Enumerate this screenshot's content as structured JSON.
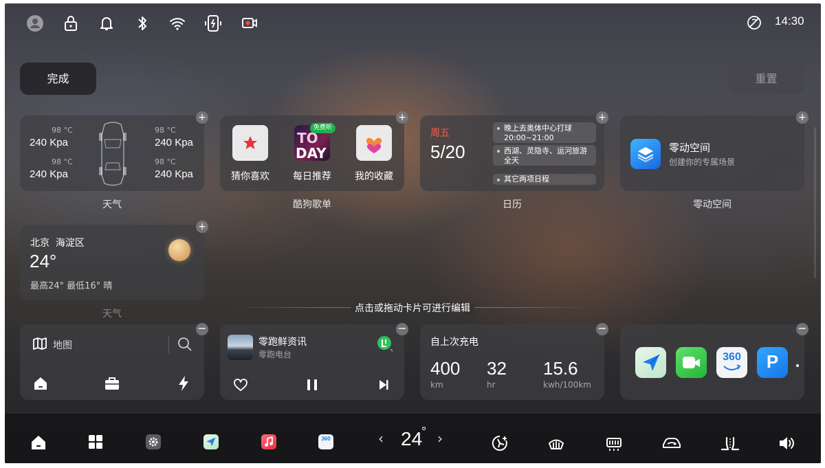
{
  "status_bar": {
    "time": "14:30",
    "icons": [
      "profile-icon",
      "lock-icon",
      "bell-icon",
      "bluetooth-icon",
      "wifi-icon",
      "phone-charge-icon",
      "dashcam-icon",
      "no-signal-icon"
    ]
  },
  "edit_mode": {
    "done_label": "完成",
    "reset_label": "重置",
    "hint": "点击或拖动卡片可进行编辑"
  },
  "tire_card": {
    "caption": "天气",
    "tires": [
      {
        "temp": "98 °C",
        "pressure": "240 Kpa"
      },
      {
        "temp": "98 °C",
        "pressure": "240 Kpa"
      },
      {
        "temp": "98 °C",
        "pressure": "240 Kpa"
      },
      {
        "temp": "98 °C",
        "pressure": "240 Kpa"
      }
    ]
  },
  "music_card": {
    "caption": "酷狗歌单",
    "badge": "免费听",
    "items": [
      {
        "label": "猜你喜欢",
        "icon": "star-icon"
      },
      {
        "label": "每日推荐",
        "icon": "today-cover-icon"
      },
      {
        "label": "我的收藏",
        "icon": "heart-icon"
      }
    ]
  },
  "calendar_card": {
    "caption": "日历",
    "weekday": "周五",
    "date": "5/20",
    "events": [
      {
        "title": "晚上去奥体中心打球",
        "time": "20:00~21:00"
      },
      {
        "title": "西湖、灵隐寺、运河旅游",
        "time": "全天"
      },
      {
        "title": "其它两项日程",
        "time": ""
      }
    ]
  },
  "space_card": {
    "caption": "零动空间",
    "title": "零动空间",
    "subtitle": "创建你的专属场景"
  },
  "weather_card": {
    "caption": "天气",
    "city": "北京",
    "district": "海淀区",
    "temp": "24°",
    "range": "最高24° 最低16° 晴"
  },
  "map_card": {
    "label": "地图",
    "shortcuts": [
      "home-icon",
      "briefcase-icon",
      "bolt-icon"
    ]
  },
  "media_card": {
    "title": "零跑鲜资讯",
    "subtitle": "零跑电台"
  },
  "charge_card": {
    "title": "自上次充电",
    "stats": [
      {
        "value": "400",
        "unit": "km"
      },
      {
        "value": "32",
        "unit": "hr"
      },
      {
        "value": "15.6",
        "unit": "kwh/100km"
      }
    ]
  },
  "apps_card": {
    "apps": [
      "navigation-app-icon",
      "video-call-app-icon",
      "camera-360-app-icon",
      "parking-app-icon"
    ],
    "app_360_label": "360",
    "app_p_label": "P"
  },
  "dock": {
    "temperature": "24",
    "degree": "°",
    "prev": "‹",
    "next": "›"
  },
  "colors": {
    "accent_red": "#ff5a4a",
    "card_bg": "rgba(62,62,66,.72)"
  }
}
